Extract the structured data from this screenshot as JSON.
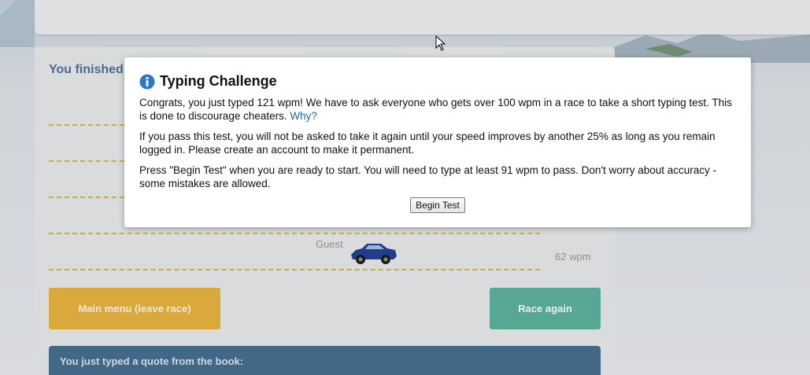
{
  "race": {
    "title": "You finished",
    "guest_label": "Guest",
    "wpm_label": "62 wpm",
    "main_menu_label": "Main menu (leave race)",
    "race_again_label": "Race again",
    "quote_label": "You just typed a quote from the book:"
  },
  "modal": {
    "title": "Typing Challenge",
    "para1_text": "Congrats, you just typed 121 wpm! We have to ask everyone who gets over 100 wpm in a race to take a short typing test. This is done to discourage cheaters.",
    "para1_link": "Why?",
    "para2_text": "If you pass this test, you will not be asked to take it again until your speed improves by another 25% as long as you remain logged in. Please create an account to make it permanent.",
    "para3_text": "Press \"Begin Test\" when you are ready to start. You will need to type at least 91 wpm to pass. Don't worry about accuracy - some mistakes are allowed.",
    "begin_button_label": "Begin Test"
  },
  "colors": {
    "main_menu_button": "#d9a93e",
    "race_again_button": "#58a694",
    "quote_panel": "#436887",
    "car": "#1f3d8a",
    "info_icon": "#2a7bc4"
  },
  "icons": {
    "info": "info-icon",
    "car": "car-icon",
    "cursor": "mouse-cursor-icon"
  }
}
